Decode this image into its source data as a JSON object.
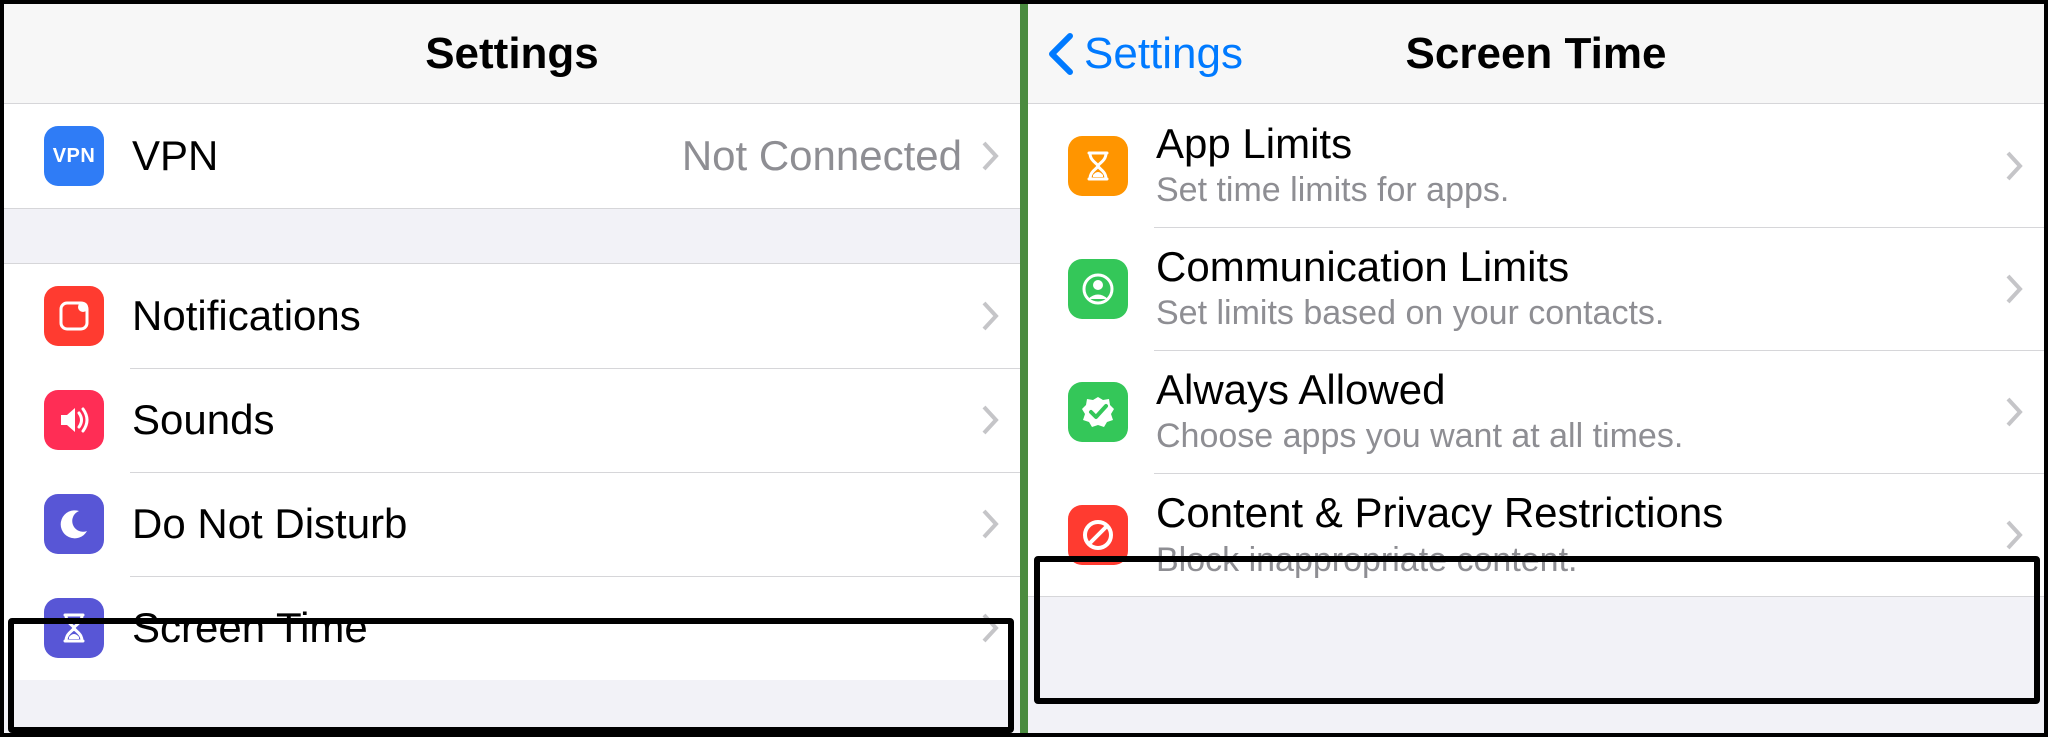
{
  "left": {
    "title": "Settings",
    "group1": [
      {
        "label": "VPN",
        "detail": "Not Connected",
        "icon": "vpn",
        "color": "c-blue"
      }
    ],
    "group2": [
      {
        "label": "Notifications",
        "icon": "notifications",
        "color": "c-red"
      },
      {
        "label": "Sounds",
        "icon": "sounds",
        "color": "c-pink"
      },
      {
        "label": "Do Not Disturb",
        "icon": "dnd",
        "color": "c-indigo"
      },
      {
        "label": "Screen Time",
        "icon": "hourglass",
        "color": "c-indigo"
      }
    ]
  },
  "right": {
    "back": "Settings",
    "title": "Screen Time",
    "rows": [
      {
        "label": "App Limits",
        "subtitle": "Set time limits for apps.",
        "icon": "hourglass",
        "color": "c-orange"
      },
      {
        "label": "Communication Limits",
        "subtitle": "Set limits based on your contacts.",
        "icon": "contact",
        "color": "c-green"
      },
      {
        "label": "Always Allowed",
        "subtitle": "Choose apps you want at all times.",
        "icon": "check",
        "color": "c-green"
      },
      {
        "label": "Content & Privacy Restrictions",
        "subtitle": "Block inappropriate content.",
        "icon": "nosign",
        "color": "c-red"
      }
    ]
  }
}
